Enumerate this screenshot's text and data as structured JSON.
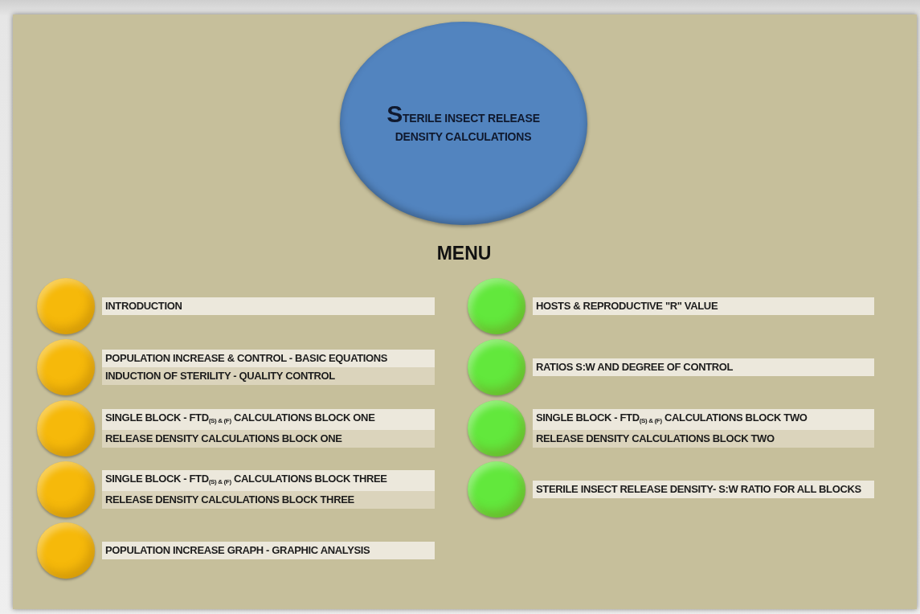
{
  "title": {
    "lines": [
      "STERILE INSECT RELEASE",
      "DENSITY CALCULATIONS"
    ]
  },
  "menu": {
    "heading": "MENU",
    "columns": [
      {
        "items": [
          {
            "color": "#f6b90a",
            "lines": [
              "INTRODUCTION"
            ]
          },
          {
            "color": "#f6b90a",
            "lines": [
              "POPULATION INCREASE & CONTROL  - BASIC EQUATIONS",
              "INDUCTION OF STERILITY - QUALITY CONTROL"
            ]
          },
          {
            "color": "#f6b90a",
            "lines": [
              "SINGLE BLOCK - FTD$_{(S) & (F)}$ CALCULATIONS BLOCK ONE",
              "RELEASE DENSITY CALCULATIONS BLOCK ONE"
            ]
          },
          {
            "color": "#f6b90a",
            "lines": [
              "SINGLE BLOCK - FTD$_{(S) & (F)}$ CALCULATIONS BLOCK THREE",
              "RELEASE DENSITY CALCULATIONS BLOCK THREE"
            ]
          },
          {
            "color": "#f6b90a",
            "lines": [
              "POPULATION INCREASE GRAPH - GRAPHIC ANALYSIS"
            ]
          }
        ]
      },
      {
        "items": [
          {
            "color": "#62e83c",
            "lines": [
              "HOSTS & REPRODUCTIVE \"R\" VALUE"
            ]
          },
          {
            "color": "#62e83c",
            "lines": [
              "RATIOS S:W AND DEGREE OF CONTROL"
            ]
          },
          {
            "color": "#62e83c",
            "lines": [
              "SINGLE BLOCK - FTD$_{(S) & (F)}$ CALCULATIONS BLOCK TWO",
              "RELEASE DENSITY CALCULATIONS BLOCK TWO"
            ]
          },
          {
            "color": "#62e83c",
            "lines": [
              "STERILE INSECT RELEASE DENSITY- S:W RATIO FOR ALL BLOCKS"
            ]
          }
        ]
      }
    ]
  }
}
